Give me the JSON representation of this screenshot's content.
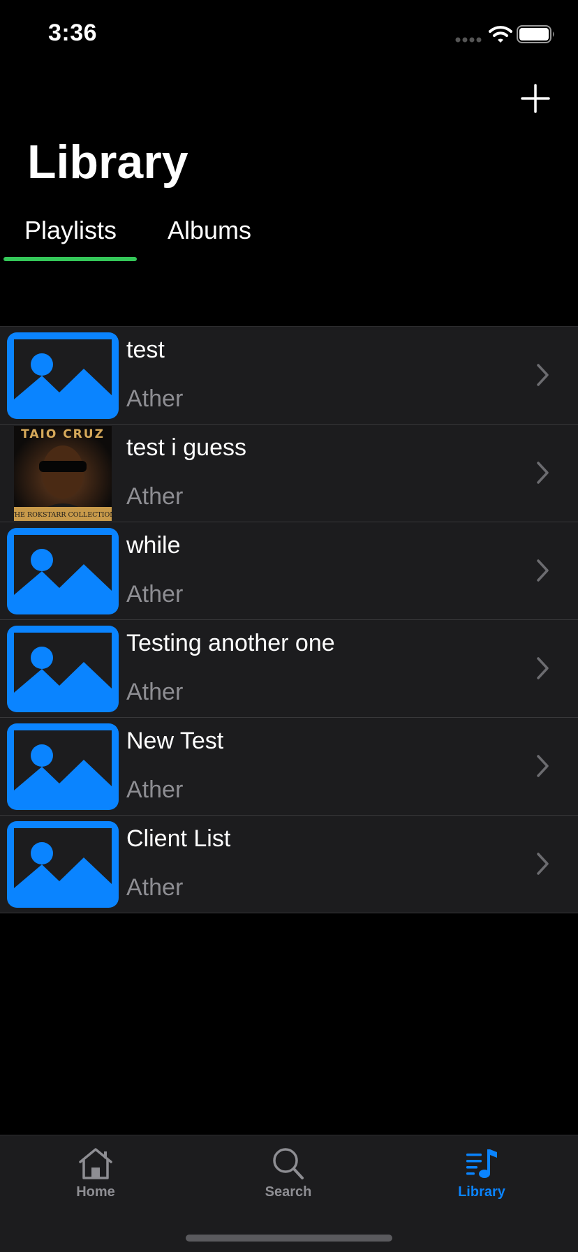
{
  "status_bar": {
    "time": "3:36",
    "signal_icon": "cellular-signal-icon",
    "wifi_icon": "wifi-icon",
    "battery_icon": "battery-icon"
  },
  "header": {
    "title": "Library",
    "add_icon": "plus-icon"
  },
  "tabs": {
    "items": [
      {
        "label": "Playlists",
        "selected": true
      },
      {
        "label": "Albums",
        "selected": false
      }
    ],
    "indicator_color": "#34c759"
  },
  "playlists": [
    {
      "title": "test",
      "subtitle": "Ather",
      "artwork": "image-placeholder-icon"
    },
    {
      "title": "test i guess",
      "subtitle": "Ather",
      "artwork": "album-cover",
      "album_cover": {
        "artist_text": "TAIO CRUZ",
        "collection_text": "THE ROKSTARR COLLECTION"
      }
    },
    {
      "title": "while",
      "subtitle": "Ather",
      "artwork": "image-placeholder-icon"
    },
    {
      "title": "Testing another one",
      "subtitle": "Ather",
      "artwork": "image-placeholder-icon"
    },
    {
      "title": "New Test",
      "subtitle": "Ather",
      "artwork": "image-placeholder-icon"
    },
    {
      "title": "Client List",
      "subtitle": "Ather",
      "artwork": "image-placeholder-icon"
    }
  ],
  "tab_bar": {
    "items": [
      {
        "label": "Home",
        "icon": "house-icon",
        "selected": false
      },
      {
        "label": "Search",
        "icon": "magnifying-glass-icon",
        "selected": false
      },
      {
        "label": "Library",
        "icon": "music-library-icon",
        "selected": true
      }
    ],
    "active_color": "#0a84ff",
    "inactive_color": "#8e8e93"
  }
}
